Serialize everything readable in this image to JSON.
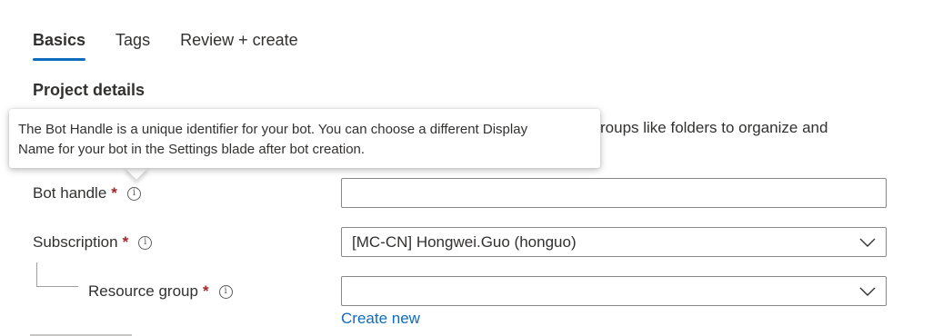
{
  "tabs": [
    {
      "label": "Basics",
      "active": true
    },
    {
      "label": "Tags",
      "active": false
    },
    {
      "label": "Review + create",
      "active": false
    }
  ],
  "section_title": "Project details",
  "description_tail": "roups like folders to organize and",
  "tooltip": {
    "line1": "The Bot Handle is a unique identifier for your bot. You can choose a different Display",
    "line2": "Name for your bot in the Settings blade after bot creation."
  },
  "form": {
    "bot_handle": {
      "label": "Bot handle",
      "required_mark": "*",
      "value": "",
      "info_icon": "info-icon"
    },
    "subscription": {
      "label": "Subscription",
      "required_mark": "*",
      "value": "[MC-CN] Hongwei.Guo (honguo)",
      "info_icon": "info-icon"
    },
    "resource_group": {
      "label": "Resource group",
      "required_mark": "*",
      "value": "",
      "info_icon": "info-icon"
    },
    "create_new_link": "Create new"
  },
  "colors": {
    "accent": "#0f6cbd",
    "required": "#a4262c",
    "text": "#323130",
    "border": "#8a8886"
  }
}
